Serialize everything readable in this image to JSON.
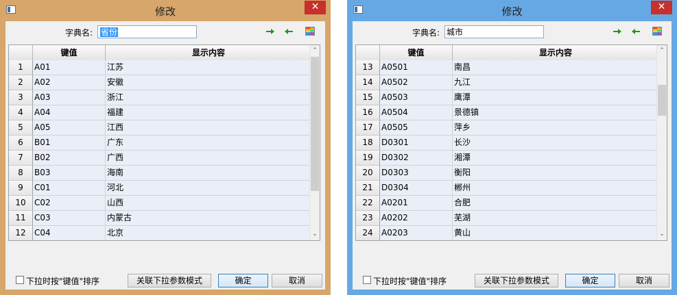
{
  "windows": [
    {
      "title": "修改",
      "close_glyph": "✕",
      "dict_label": "字典名:",
      "dict_value": "省份",
      "dict_selected": true,
      "columns": {
        "key": "键值",
        "display": "显示内容"
      },
      "rows": [
        {
          "n": "1",
          "key": "A01",
          "val": "江苏"
        },
        {
          "n": "2",
          "key": "A02",
          "val": "安徽"
        },
        {
          "n": "3",
          "key": "A03",
          "val": "浙江"
        },
        {
          "n": "4",
          "key": "A04",
          "val": "福建"
        },
        {
          "n": "5",
          "key": "A05",
          "val": "江西"
        },
        {
          "n": "6",
          "key": "B01",
          "val": "广东"
        },
        {
          "n": "7",
          "key": "B02",
          "val": "广西"
        },
        {
          "n": "8",
          "key": "B03",
          "val": "海南"
        },
        {
          "n": "9",
          "key": "C01",
          "val": "河北"
        },
        {
          "n": "10",
          "key": "C02",
          "val": "山西"
        },
        {
          "n": "11",
          "key": "C03",
          "val": "内蒙古"
        },
        {
          "n": "12",
          "key": "C04",
          "val": "北京"
        }
      ],
      "scroll_position": 0.0,
      "scroll_visible_fraction": 0.78,
      "sort_label": "下拉时按\"键值\"排序",
      "sort_checked": false,
      "link_button": "关联下拉参数模式",
      "ok_button": "确定",
      "cancel_button": "取消",
      "frame_color": "#d6a66a"
    },
    {
      "title": "修改",
      "close_glyph": "✕",
      "dict_label": "字典名:",
      "dict_value": "城市",
      "dict_selected": false,
      "columns": {
        "key": "键值",
        "display": "显示内容"
      },
      "rows": [
        {
          "n": "13",
          "key": "A0501",
          "val": "南昌"
        },
        {
          "n": "14",
          "key": "A0502",
          "val": "九江"
        },
        {
          "n": "15",
          "key": "A0503",
          "val": "鹰潭"
        },
        {
          "n": "16",
          "key": "A0504",
          "val": "景德镇"
        },
        {
          "n": "17",
          "key": "A0505",
          "val": "萍乡"
        },
        {
          "n": "18",
          "key": "D0301",
          "val": "长沙"
        },
        {
          "n": "19",
          "key": "D0302",
          "val": "湘潭"
        },
        {
          "n": "20",
          "key": "D0303",
          "val": "衡阳"
        },
        {
          "n": "21",
          "key": "D0304",
          "val": "郴州"
        },
        {
          "n": "22",
          "key": "A0201",
          "val": "合肥"
        },
        {
          "n": "23",
          "key": "A0202",
          "val": "芜湖"
        },
        {
          "n": "24",
          "key": "A0203",
          "val": "黄山"
        }
      ],
      "scroll_position": 0.2,
      "scroll_visible_fraction": 0.18,
      "sort_label": "下拉时按\"键值\"排序",
      "sort_checked": false,
      "link_button": "关联下拉参数模式",
      "ok_button": "确定",
      "cancel_button": "取消",
      "frame_color": "#66a8e4"
    }
  ],
  "icons": {
    "forward": "green-right-arrow-icon",
    "back": "green-left-arrow-icon",
    "grid": "color-grid-icon"
  },
  "colors": {
    "arrow": "#1a9a1a",
    "selection": "#3399ff",
    "close": "#c7302b"
  }
}
